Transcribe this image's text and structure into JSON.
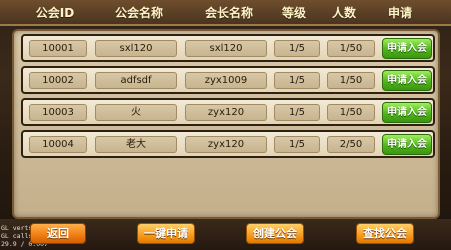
{
  "header": {
    "col_id": "公会ID",
    "col_name": "公会名称",
    "col_leader": "会长名称",
    "col_level": "等级",
    "col_members": "人数",
    "col_apply": "申请"
  },
  "guilds": [
    {
      "id": "10001",
      "name": "sxl120",
      "leader": "sxl120",
      "level": "1/5",
      "members": "1/50",
      "apply_label": "申请入会"
    },
    {
      "id": "10002",
      "name": "adfsdf",
      "leader": "zyx1009",
      "level": "1/5",
      "members": "1/50",
      "apply_label": "申请入会"
    },
    {
      "id": "10003",
      "name": "火",
      "leader": "zyx120",
      "level": "1/5",
      "members": "1/50",
      "apply_label": "申请入会"
    },
    {
      "id": "10004",
      "name": "老大",
      "leader": "zyx120",
      "level": "1/5",
      "members": "2/50",
      "apply_label": "申请入会"
    }
  ],
  "buttons": {
    "back": "返回",
    "quick_apply": "一键申请",
    "create": "创建公会",
    "search": "查找公会"
  },
  "debug": {
    "line1": "GL verts",
    "line2": "GL calls",
    "line3": "29.9 / 0.007"
  },
  "colors": {
    "apply_button": "#4fb51a",
    "action_button": "#f79a1c",
    "frame": "#3b2a1a"
  }
}
